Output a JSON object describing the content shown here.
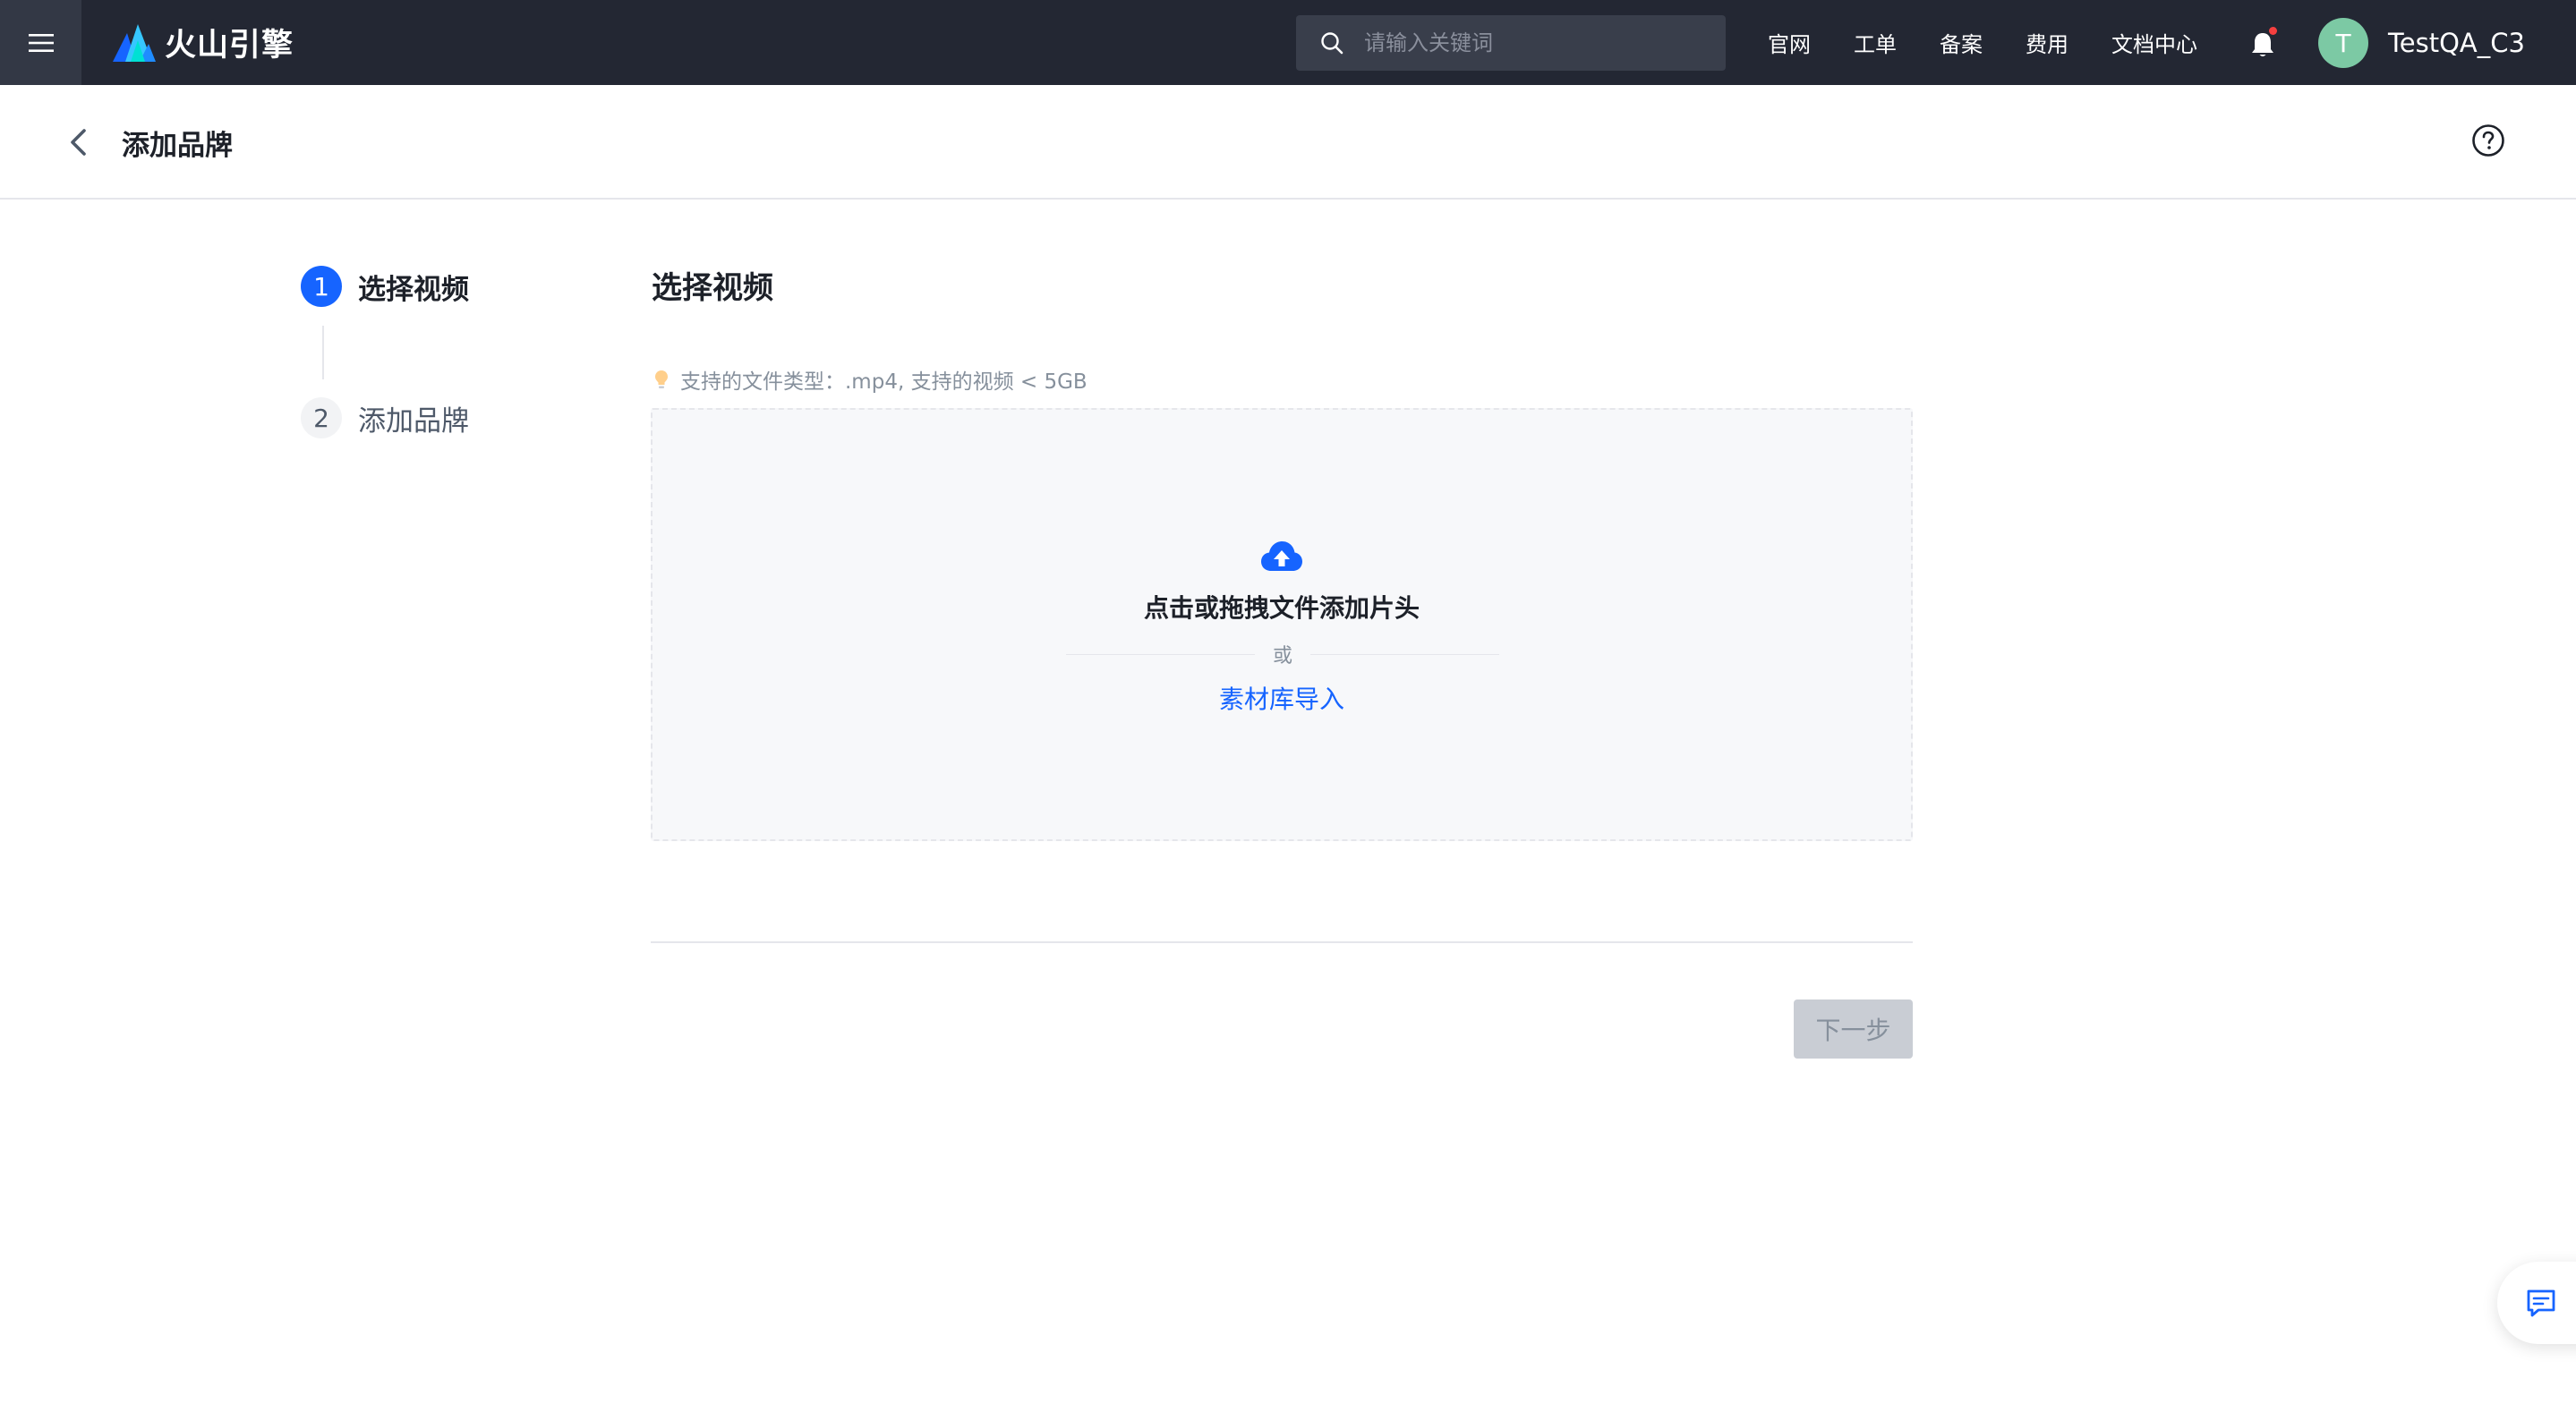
{
  "topbar": {
    "brand": "火山引擎",
    "search_placeholder": "请输入关键词",
    "links": [
      "官网",
      "工单",
      "备案",
      "费用",
      "文档中心"
    ],
    "avatar_letter": "T",
    "username": "TestQA_C3",
    "notification_dot_color": "#f53f3f"
  },
  "page": {
    "title": "添加品牌"
  },
  "steps": [
    {
      "number": "1",
      "label": "选择视频",
      "state": "active"
    },
    {
      "number": "2",
      "label": "添加品牌",
      "state": "inactive"
    }
  ],
  "main": {
    "section_title": "选择视频",
    "tip": "支持的文件类型：.mp4, 支持的视频 < 5GB",
    "upload_text": "点击或拖拽文件添加片头",
    "or_text": "或",
    "import_link": "素材库导入",
    "next_button": "下一步"
  },
  "colors": {
    "primary": "#1664ff",
    "topbar_bg": "#232733",
    "avatar_bg": "#7cc9a4",
    "disabled_button_bg": "#c9cdd4"
  },
  "icons": {
    "menu": "hamburger-icon",
    "logo": "volcano-logo",
    "search": "search-icon",
    "bell": "bell-icon",
    "back": "chevron-left-icon",
    "help": "question-circle-icon",
    "tip": "lightbulb-icon",
    "upload": "cloud-upload-icon",
    "feedback": "message-icon"
  }
}
